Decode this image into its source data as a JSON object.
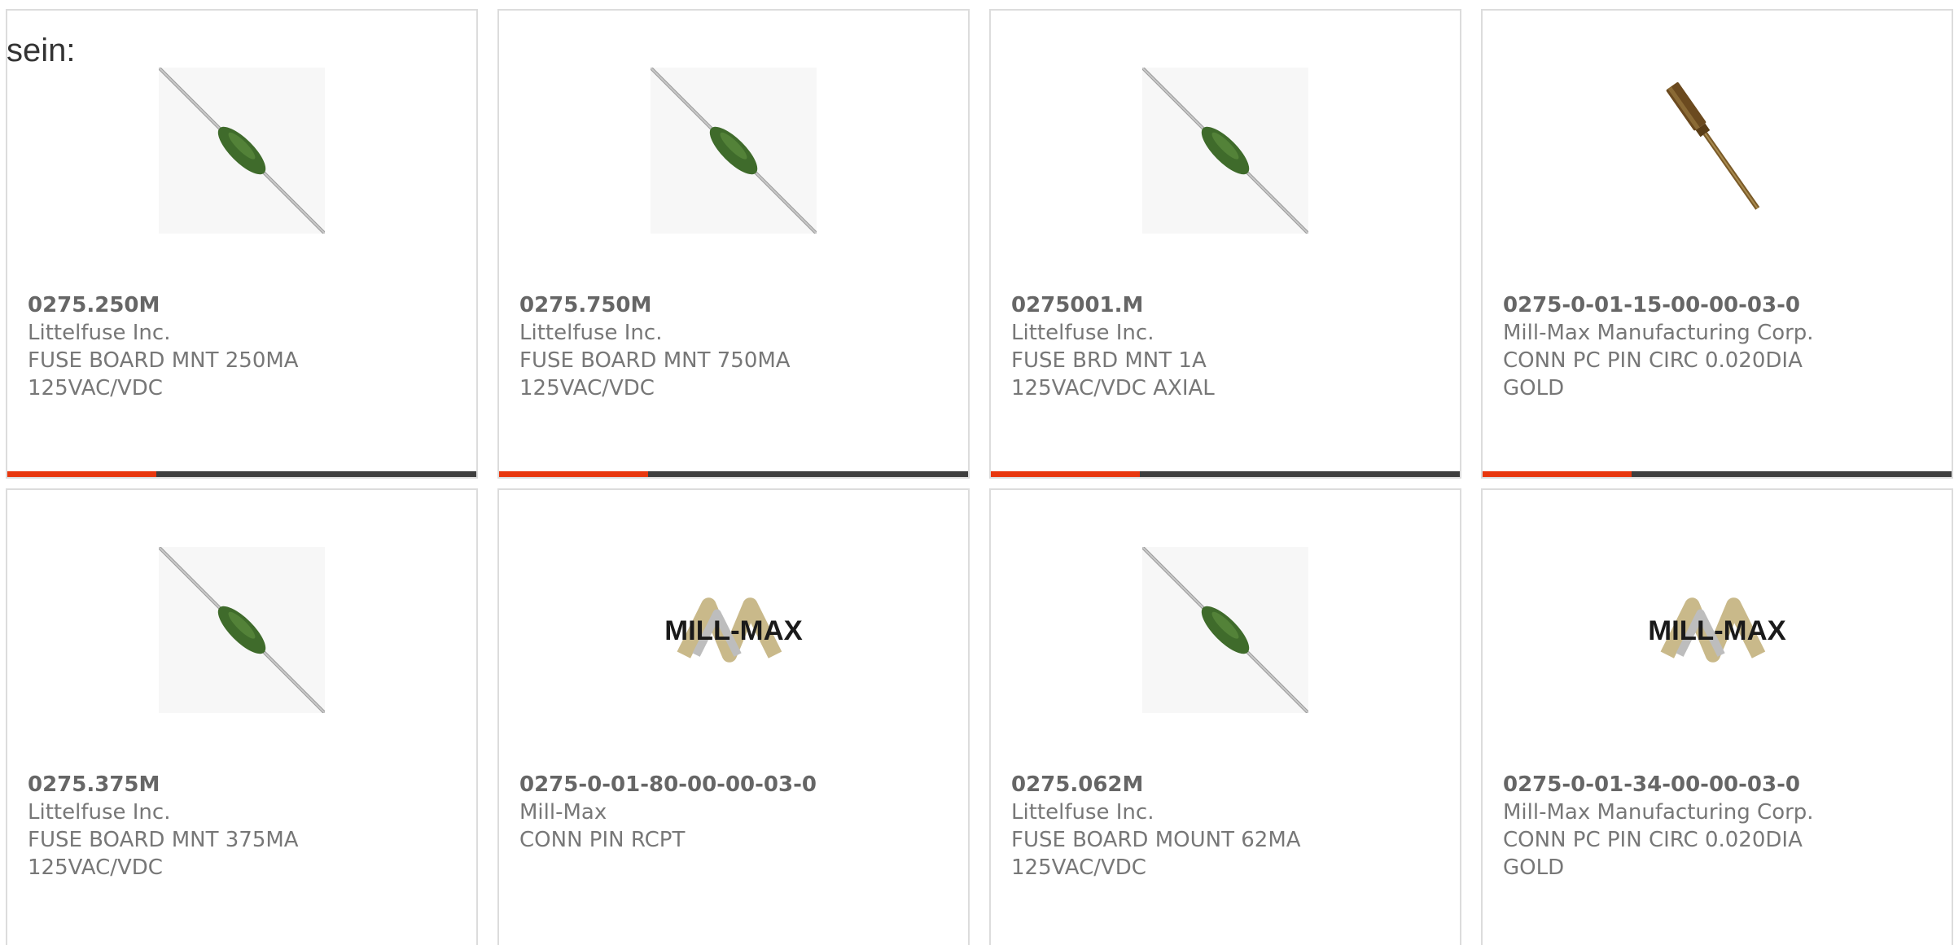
{
  "intro_text": "sein:",
  "colors": {
    "accent": "#e8370e",
    "bar": "#3e3e3e",
    "card_border": "#dcdcdc",
    "text_muted": "#777777",
    "text_strong": "#666666"
  },
  "products": [
    {
      "part_number": "0275.250M",
      "manufacturer": "Littelfuse Inc.",
      "description": "FUSE BOARD MNT 250MA 125VAC/VDC",
      "image": "axial-fuse-image"
    },
    {
      "part_number": "0275.750M",
      "manufacturer": "Littelfuse Inc.",
      "description": "FUSE BOARD MNT 750MA 125VAC/VDC",
      "image": "axial-fuse-image"
    },
    {
      "part_number": "0275001.M",
      "manufacturer": "Littelfuse Inc.",
      "description": "FUSE BRD MNT 1A 125VAC/VDC AXIAL",
      "image": "axial-fuse-image"
    },
    {
      "part_number": "0275-0-01-15-00-00-03-0",
      "manufacturer": "Mill-Max Manufacturing Corp.",
      "description": "CONN PC PIN CIRC 0.020DIA GOLD",
      "image": "pc-pin-image"
    },
    {
      "part_number": "0275.375M",
      "manufacturer": "Littelfuse Inc.",
      "description": "FUSE BOARD MNT 375MA 125VAC/VDC",
      "image": "axial-fuse-image"
    },
    {
      "part_number": "0275-0-01-80-00-00-03-0",
      "manufacturer": "Mill-Max",
      "description": "CONN PIN RCPT",
      "image": "mill-max-logo",
      "logo_text": "MILL-MAX"
    },
    {
      "part_number": "0275.062M",
      "manufacturer": "Littelfuse Inc.",
      "description": "FUSE BOARD MOUNT 62MA 125VAC/VDC",
      "image": "axial-fuse-image"
    },
    {
      "part_number": "0275-0-01-34-00-00-03-0",
      "manufacturer": "Mill-Max Manufacturing Corp.",
      "description": "CONN PC PIN CIRC 0.020DIA GOLD",
      "image": "mill-max-logo",
      "logo_text": "MILL-MAX"
    }
  ]
}
